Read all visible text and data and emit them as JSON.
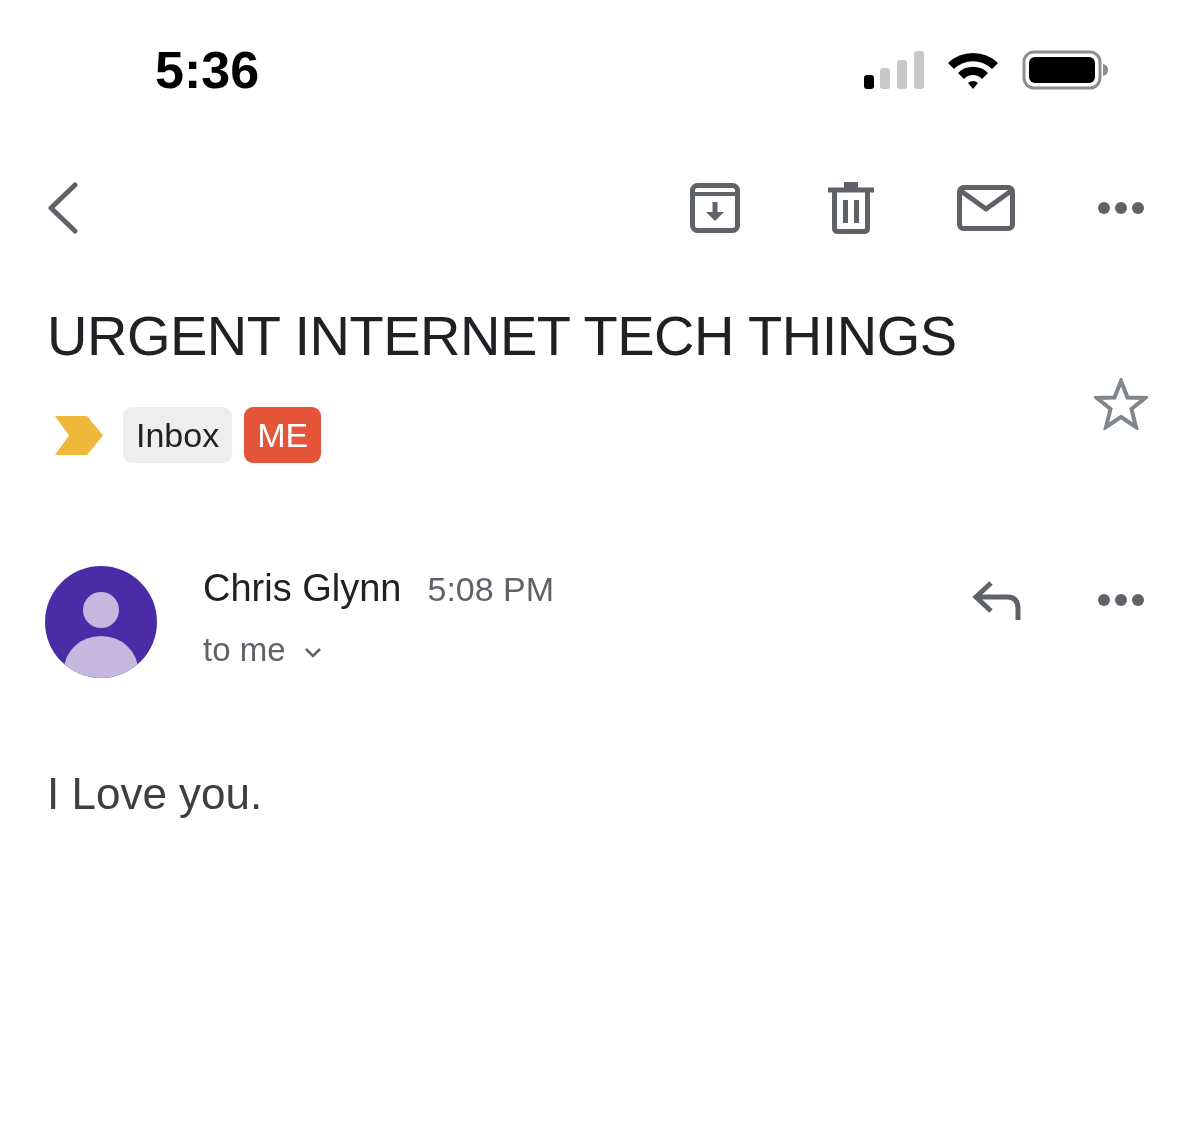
{
  "status_bar": {
    "time": "5:36"
  },
  "subject": {
    "text": "URGENT INTERNET TECH THINGS",
    "important": true,
    "starred": false
  },
  "labels": [
    {
      "text": "Inbox",
      "color": "#eeeeee"
    },
    {
      "text": "ME",
      "color": "#e5553a"
    }
  ],
  "message": {
    "sender": "Chris Glynn",
    "time": "5:08 PM",
    "recipient": "to me",
    "details_expanded": false,
    "body": "I Love you."
  }
}
